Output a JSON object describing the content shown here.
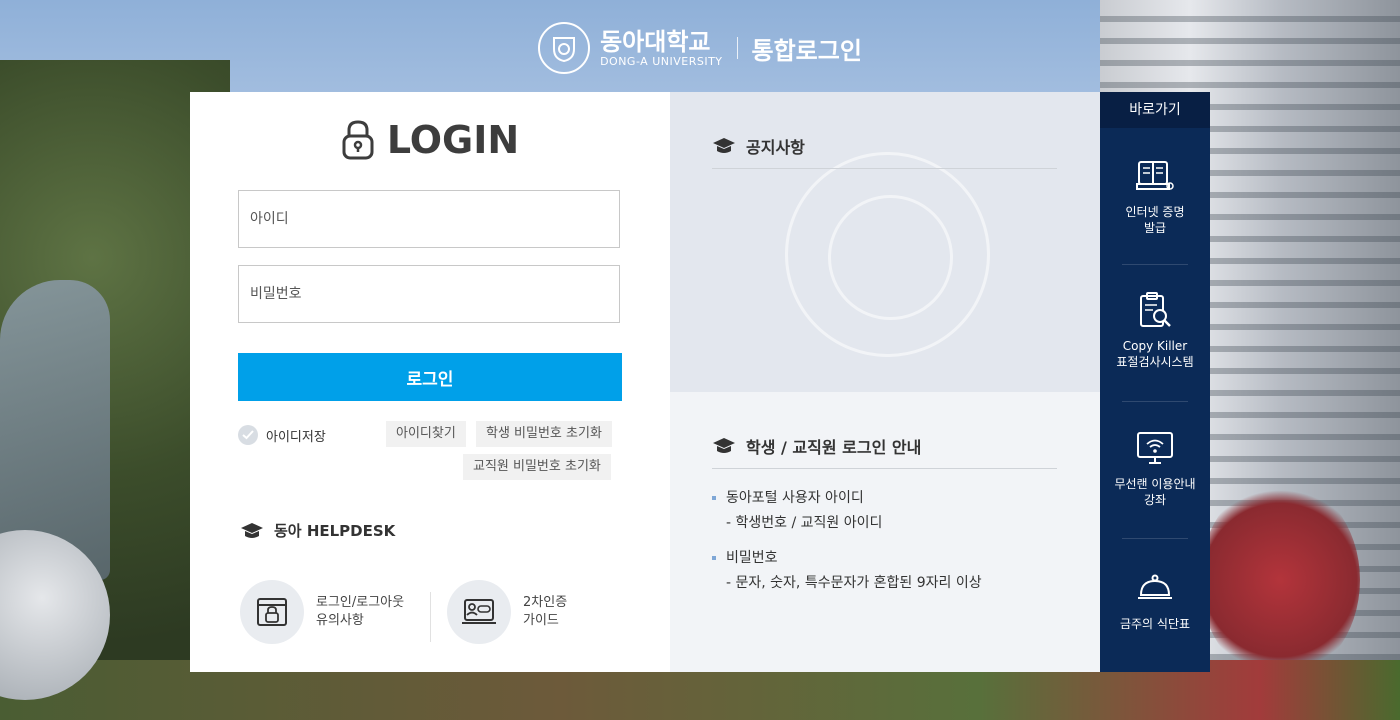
{
  "header": {
    "brand_kr": "동아대학교",
    "brand_en": "DONG-A UNIVERSITY",
    "subtitle": "통합로그인"
  },
  "login": {
    "title": "LOGIN",
    "id_placeholder": "아이디",
    "pw_placeholder": "비밀번호",
    "button_label": "로그인",
    "save_id_label": "아이디저장",
    "find_id_label": "아이디찾기",
    "reset_student_label": "학생 비밀번호 초기화",
    "reset_staff_label": "교직원 비밀번호 초기화"
  },
  "helpdesk": {
    "title": "동아 HELPDESK",
    "items": [
      {
        "line1": "로그인/로그아웃",
        "line2": "유의사항"
      },
      {
        "line1": "2차인증",
        "line2": "가이드"
      }
    ]
  },
  "notice": {
    "title": "공지사항"
  },
  "guide": {
    "title": "학생 / 교직원 로그인 안내",
    "items": [
      {
        "main": "동아포털 사용자 아이디",
        "sub": "- 학생번호 / 교직원 아이디"
      },
      {
        "main": "비밀번호",
        "sub": "- 문자, 숫자, 특수문자가 혼합된 9자리 이상"
      }
    ]
  },
  "quick": {
    "title": "바로가기",
    "items": [
      {
        "line1": "인터넷 증명",
        "line2": "발급"
      },
      {
        "line1": "Copy Killer",
        "line2": "표절검사시스템"
      },
      {
        "line1": "무선랜 이용안내",
        "line2": "강좌"
      },
      {
        "line1": "금주의 식단표",
        "line2": ""
      }
    ]
  },
  "colors": {
    "accent": "#00a0e9",
    "quick_bg": "#0b2a57",
    "text": "#333333"
  }
}
